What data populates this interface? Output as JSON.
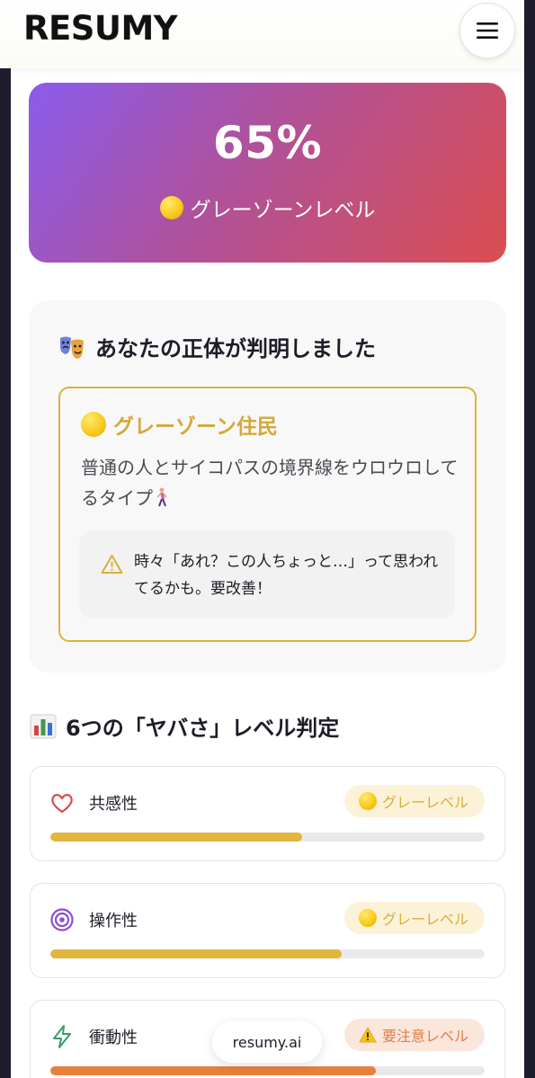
{
  "header": {
    "logo": "RESUMY",
    "menu_icon": "hamburger-menu-icon"
  },
  "score": {
    "percent": "65%",
    "level_label": "グレーゾーンレベル",
    "level_icon": "yellow-circle-icon"
  },
  "identity": {
    "title": "あなたの正体が判明しました",
    "title_icon": "theater-masks-icon",
    "type_name": "グレーゾーン住民",
    "type_icon": "yellow-circle-icon",
    "description": "普通の人とサイコパスの境界線をウロウロしてるタイプ",
    "description_icon": "person-walking-icon",
    "warning": "時々「あれ？この人ちょっと…」って思われてるかも。要改善！",
    "warning_icon": "warning-triangle-icon"
  },
  "traits_section": {
    "title": "6つの「ヤバさ」レベル判定",
    "title_icon": "bar-chart-icon",
    "items": [
      {
        "name": "共感性",
        "icon": "heart-icon",
        "badge": "グレーレベル",
        "badge_icon": "yellow-circle-icon",
        "level": 0.58,
        "bar_color": "#e2b63e"
      },
      {
        "name": "操作性",
        "icon": "target-icon",
        "badge": "グレーレベル",
        "badge_icon": "yellow-circle-icon",
        "level": 0.67,
        "bar_color": "#e2b63e"
      },
      {
        "name": "衝動性",
        "icon": "lightning-icon",
        "badge": "要注意レベル",
        "badge_icon": "warning-icon",
        "level": 0.75,
        "bar_color": "#e8803c"
      }
    ]
  },
  "footer": {
    "domain": "resumy.ai"
  },
  "colors": {
    "accent_gold": "#dcb43a",
    "gradient_start": "#8a5cec",
    "gradient_end": "#db4e50",
    "caution_orange": "#e07e45"
  }
}
